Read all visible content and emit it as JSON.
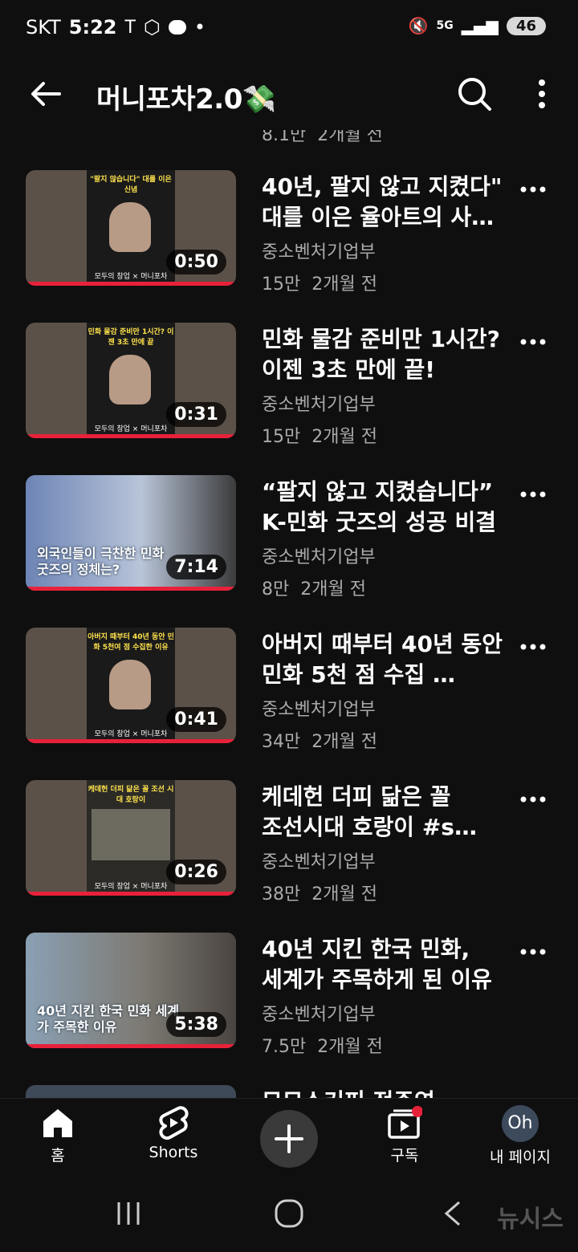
{
  "status_bar": {
    "carrier": "SKT",
    "time": "5:22",
    "dot": "•",
    "network": "5G",
    "battery": "46"
  },
  "header": {
    "title": "머니포차2.0💸"
  },
  "partial_top_meta": "8.1만  2개월 전",
  "videos": [
    {
      "title": "40년, 팔지 않고 지켰다\" 대를 이은 율아트의 사…",
      "channel": "중소벤처기업부",
      "meta": "15만  2개월 전",
      "duration": "0:50",
      "thumb_caption": "\"팔지 않습니다\" 대를 이은 신념",
      "thumb_footer": "모두의 창업 × 머니포차"
    },
    {
      "title": "민화 물감 준비만 1시간? 이젠 3초 만에 끝!",
      "channel": "중소벤처기업부",
      "meta": "15만  2개월 전",
      "duration": "0:31",
      "thumb_caption": "민화 물감 준비만 1시간? 이젠 3초 만에 끝",
      "thumb_footer": "모두의 창업 × 머니포차"
    },
    {
      "title": "“팔지 않고 지켰습니다” K-민화 굿즈의 성공 비결",
      "channel": "중소벤처기업부",
      "meta": "8만  2개월 전",
      "duration": "7:14",
      "thumb_caption": "외국인들이 극찬한 민화 굿즈의 정체는?"
    },
    {
      "title": "아버지 때부터 40년 동안 민화 5천 점 수집 …",
      "channel": "중소벤처기업부",
      "meta": "34만  2개월 전",
      "duration": "0:41",
      "thumb_caption": "아버지 때부터 40년 동안 민화 5천여 점 수집한 이유",
      "thumb_footer": "모두의 창업 × 머니포차"
    },
    {
      "title": "케데헌 더피 닮은 꼴 조선시대 호랑이 #s…",
      "channel": "중소벤처기업부",
      "meta": "38만  2개월 전",
      "duration": "0:26",
      "thumb_caption": "케데헌 더피 닮은 꼴 조선 시대 호랑이",
      "thumb_footer": "모두의 창업 × 머니포차"
    },
    {
      "title": "40년 지킨 한국 민화, 세계가 주목하게 된 이유",
      "channel": "중소벤처기업부",
      "meta": "7.5만  2개월 전",
      "duration": "5:38",
      "thumb_caption": "40년 지킨 한국 민화 세계가 주목한 이유"
    }
  ],
  "partial_bottom_title": "모모스커피 전주연",
  "bottom_nav": {
    "home": "홈",
    "shorts": "Shorts",
    "subscriptions": "구독",
    "profile_initials": "Oh",
    "profile": "내 페이지"
  },
  "watermark": "뉴시스",
  "colors": {
    "background": "#0f0f0f",
    "progress": "#e8213a",
    "secondary_text": "#aaaaaa"
  }
}
